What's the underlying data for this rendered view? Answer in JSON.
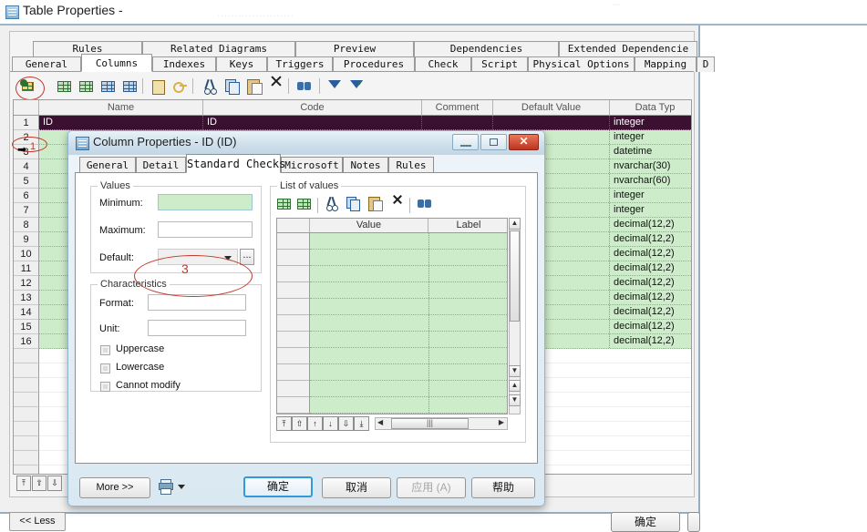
{
  "window": {
    "title": "Table Properties - ",
    "icon": "table-icon",
    "ghost_text": "......................",
    "tab_rows": [
      [
        "Rules",
        "Related Diagrams",
        "Preview",
        "Dependencies",
        "Extended Dependencie"
      ],
      [
        "General",
        "Columns",
        "Indexes",
        "Keys",
        "Triggers",
        "Procedures",
        "Check",
        "Script",
        "Physical Options",
        "Mapping",
        "D"
      ]
    ],
    "selected_tab": "Columns",
    "toolbar_icons": [
      "properties-icon",
      "insert-row-icon",
      "add-row-icon",
      "add-table-icon",
      "replace-table-icon",
      "notes-icon",
      "key-icon",
      "cut-icon",
      "copy-icon",
      "paste-icon",
      "delete-icon",
      "find-icon",
      "filter-edit-icon",
      "filter-apply-icon"
    ],
    "grid": {
      "columns": [
        "Name",
        "Code",
        "Comment",
        "Default Value",
        "Data Typ"
      ],
      "rows": [
        {
          "num": "1",
          "name": "ID",
          "code": "ID",
          "comment": "",
          "default": "",
          "datatype": "integer",
          "selected": true
        },
        {
          "num": "2",
          "name": "",
          "code": "",
          "comment": "",
          "default": "",
          "datatype": "integer"
        },
        {
          "num": "3",
          "name": "",
          "code": "",
          "comment": "",
          "default": "",
          "datatype": "datetime"
        },
        {
          "num": "4",
          "name": "",
          "code": "",
          "comment": "",
          "default": "",
          "datatype": "nvarchar(30)"
        },
        {
          "num": "5",
          "name": "",
          "code": "",
          "comment": "",
          "default": "",
          "datatype": "nvarchar(60)"
        },
        {
          "num": "6",
          "name": "",
          "code": "",
          "comment": "",
          "default": "",
          "datatype": "integer"
        },
        {
          "num": "7",
          "name": "",
          "code": "",
          "comment": "",
          "default": "",
          "datatype": "integer"
        },
        {
          "num": "8",
          "name": "",
          "code": "",
          "comment": "",
          "default": "",
          "datatype": "decimal(12,2)"
        },
        {
          "num": "9",
          "name": "",
          "code": "",
          "comment": "",
          "default": "",
          "datatype": "decimal(12,2)"
        },
        {
          "num": "10",
          "name": "",
          "code": "",
          "comment": "",
          "default": "",
          "datatype": "decimal(12,2)"
        },
        {
          "num": "11",
          "name": "",
          "code": "",
          "comment": "",
          "default": "",
          "datatype": "decimal(12,2)"
        },
        {
          "num": "12",
          "name": "",
          "code": "",
          "comment": "",
          "default": "",
          "datatype": "decimal(12,2)"
        },
        {
          "num": "13",
          "name": "",
          "code": "",
          "comment": "",
          "default": "",
          "datatype": "decimal(12,2)"
        },
        {
          "num": "14",
          "name": "",
          "code": "",
          "comment": "",
          "default": "",
          "datatype": "decimal(12,2)"
        },
        {
          "num": "15",
          "name": "",
          "code": "",
          "comment": "",
          "default": "",
          "datatype": "decimal(12,2)"
        },
        {
          "num": "16",
          "name": "",
          "code": "",
          "comment": "",
          "default": "",
          "datatype": "decimal(12,2)"
        }
      ],
      "blank_rows": 9,
      "nav_buttons": [
        "⤒",
        "↑",
        "↓"
      ]
    },
    "less_button": "<< Less",
    "ok_button": "确定"
  },
  "dialog": {
    "title": "Column Properties - ID (ID)",
    "icon": "column-properties-icon",
    "window_buttons": {
      "minimize": "minimize-icon",
      "maximize": "maximize-icon",
      "close": "✕"
    },
    "tabs": [
      "General",
      "Detail",
      "Standard Checks",
      "Microsoft",
      "Notes",
      "Rules"
    ],
    "selected_tab": "Standard Checks",
    "values_group": {
      "legend": "Values",
      "minimum_label": "Minimum:",
      "minimum_value": "",
      "maximum_label": "Maximum:",
      "maximum_value": "",
      "default_label": "Default:",
      "default_value": "",
      "ellipsis_button": "..."
    },
    "characteristics_group": {
      "legend": "Characteristics",
      "format_label": "Format:",
      "format_value": "",
      "unit_label": "Unit:",
      "unit_value": "",
      "checkboxes": [
        {
          "label": "Uppercase",
          "checked": false
        },
        {
          "label": "Lowercase",
          "checked": false
        },
        {
          "label": "Cannot modify",
          "checked": false
        }
      ]
    },
    "list_of_values": {
      "legend": "List of values",
      "toolbar_icons": [
        "insert-row-icon",
        "add-row-icon",
        "cut-icon",
        "copy-icon",
        "paste-icon",
        "delete-icon",
        "find-icon"
      ],
      "columns": [
        "Value",
        "Label"
      ],
      "rows": 11,
      "nav_buttons": [
        "⤒",
        "↑",
        "↑",
        "↓",
        "↓",
        "⤓"
      ],
      "hscroll_thumb": "|||"
    },
    "footer": {
      "more_button": "More >>",
      "print_icon": "print-icon",
      "dropdown_icon": "chevron-down-icon",
      "ok_button": "确定",
      "cancel_button": "取消",
      "apply_button": "应用 (A)",
      "help_button": "帮助"
    }
  },
  "annotations": {
    "step_number": "3",
    "row_one_marker": "1",
    "arrow_marker": "➡",
    "color": "#c0392b"
  }
}
